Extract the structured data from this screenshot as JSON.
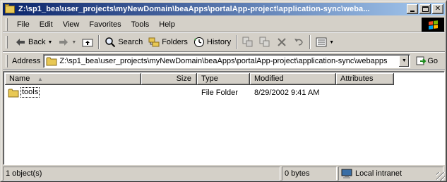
{
  "window": {
    "title": "Z:\\sp1_bea\\user_projects\\myNewDomain\\beaApps\\portalApp-project\\application-sync\\weba..."
  },
  "menu": {
    "items": [
      "File",
      "Edit",
      "View",
      "Favorites",
      "Tools",
      "Help"
    ]
  },
  "toolbar": {
    "back_label": "Back",
    "search_label": "Search",
    "folders_label": "Folders",
    "history_label": "History"
  },
  "address": {
    "label": "Address",
    "value": "Z:\\sp1_bea\\user_projects\\myNewDomain\\beaApps\\portalApp-project\\application-sync\\webapps",
    "go_label": "Go"
  },
  "list": {
    "columns": [
      "Name",
      "Size",
      "Type",
      "Modified",
      "Attributes"
    ],
    "rows": [
      {
        "name": "tools",
        "size": "",
        "type": "File Folder",
        "modified": "8/29/2002 9:41 AM",
        "attributes": ""
      }
    ]
  },
  "status": {
    "count": "1 object(s)",
    "size": "0 bytes",
    "zone": "Local intranet"
  },
  "colors": {
    "title_start": "#0a246a",
    "title_end": "#a6caf0",
    "face": "#d4d0c8",
    "folder": "#e8c854"
  }
}
